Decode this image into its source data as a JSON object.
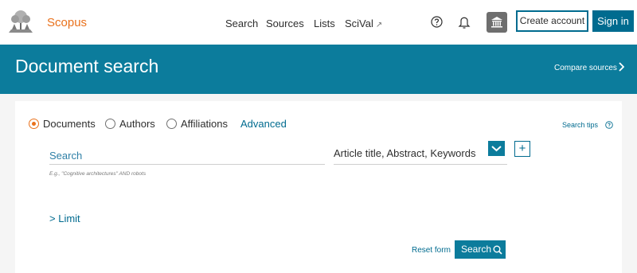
{
  "header": {
    "brand": "Scopus",
    "nav": {
      "search": "Search",
      "sources": "Sources",
      "lists": "Lists",
      "scival": "SciVal"
    },
    "scival_icon": "external-link-icon",
    "create_account": "Create account",
    "sign_in": "Sign in",
    "icons": [
      "help-circle-icon",
      "bell-icon",
      "institution-icon"
    ]
  },
  "banner": {
    "title": "Document search",
    "compare_sources": "Compare sources"
  },
  "search": {
    "options": [
      {
        "label": "Documents",
        "selected": true
      },
      {
        "label": "Authors",
        "selected": false
      },
      {
        "label": "Affiliations",
        "selected": false
      }
    ],
    "advanced": "Advanced",
    "search_tips": "Search tips",
    "input_placeholder": "Search",
    "example": "E.g., \"Cognitive architectures\" AND robots",
    "field": "Article title, Abstract, Keywords",
    "add": "+",
    "limit": "Limit",
    "reset": "Reset form",
    "submit": "Search"
  },
  "colors": {
    "brand_orange": "#e9711c",
    "banner_teal": "#0c7c9c",
    "link_blue": "#006b8f"
  }
}
